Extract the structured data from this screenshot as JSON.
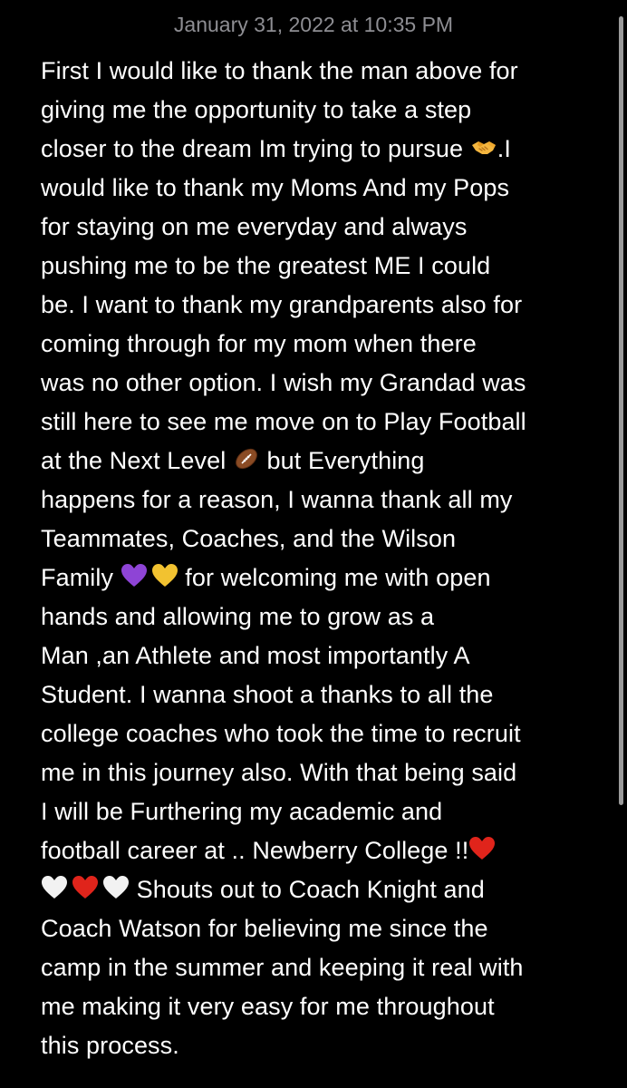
{
  "note": {
    "timestamp": "January 31, 2022 at 10:35 PM",
    "lines": [
      "First I would like to thank the man above for",
      "giving me the opportunity to take a step",
      "closer to the dream Im trying to pursue ",
      ".I",
      "would like to thank my Moms And my Pops",
      "for staying on me everyday and always",
      "pushing me to be the greatest ME I could",
      "be. I want to thank my grandparents also for",
      "coming through for my mom when there",
      "was no other option. I wish my Grandad was",
      "still here to see me move on to Play Football",
      "at the Next Level ",
      " but Everything",
      "happens for a reason, I wanna thank all my",
      "Teammates, Coaches, and the Wilson",
      "Family ",
      " for welcoming me with open",
      "hands and allowing me to grow as a",
      "Man ,an Athlete and most importantly A",
      "Student. I wanna shoot a thanks to all the",
      "college coaches who took the time to recruit",
      "me in this journey also. With that being said",
      "I will be Furthering my academic and",
      "football career at .. Newberry College !!",
      " Shouts out to Coach Knight and",
      "Coach Watson for believing me since the",
      "camp in the summer and keeping it real with",
      "me making it very easy for me throughout",
      "this process."
    ]
  },
  "emoji": {
    "handshake": "handshake-icon",
    "football": "football-icon",
    "purple_heart": "#8e44d6",
    "yellow_heart": "#f2c230",
    "red_heart": "#e0241b",
    "white_heart": "#f2f2f2"
  },
  "colors": {
    "background": "#000000",
    "text": "#ffffff",
    "timestamp": "#8e8e93"
  }
}
